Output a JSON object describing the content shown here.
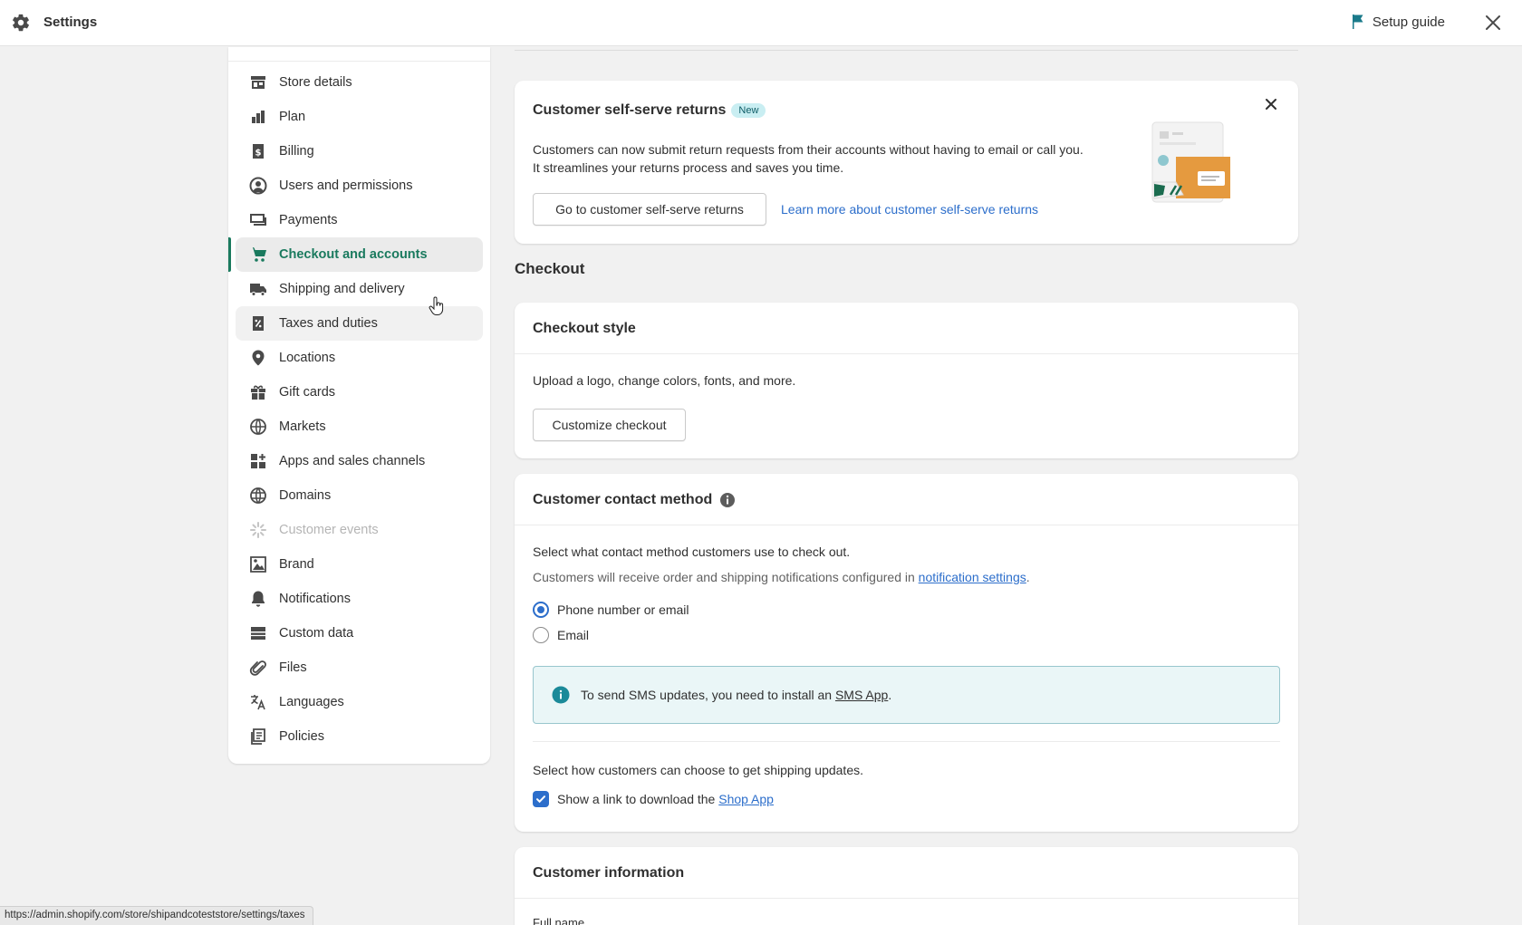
{
  "header": {
    "title": "Settings",
    "setup_guide": "Setup guide"
  },
  "sidebar": {
    "items": [
      {
        "label": "Store details",
        "icon": "store-icon"
      },
      {
        "label": "Plan",
        "icon": "plan-icon"
      },
      {
        "label": "Billing",
        "icon": "billing-icon"
      },
      {
        "label": "Users and permissions",
        "icon": "user-icon"
      },
      {
        "label": "Payments",
        "icon": "payments-icon"
      },
      {
        "label": "Checkout and accounts",
        "icon": "cart-icon",
        "state": "active"
      },
      {
        "label": "Shipping and delivery",
        "icon": "truck-icon"
      },
      {
        "label": "Taxes and duties",
        "icon": "tax-icon",
        "state": "hover"
      },
      {
        "label": "Locations",
        "icon": "location-icon"
      },
      {
        "label": "Gift cards",
        "icon": "gift-icon"
      },
      {
        "label": "Markets",
        "icon": "globe-icon"
      },
      {
        "label": "Apps and sales channels",
        "icon": "apps-icon"
      },
      {
        "label": "Domains",
        "icon": "domain-icon"
      },
      {
        "label": "Customer events",
        "icon": "sparkle-icon",
        "state": "disabled"
      },
      {
        "label": "Brand",
        "icon": "brand-icon"
      },
      {
        "label": "Notifications",
        "icon": "bell-icon"
      },
      {
        "label": "Custom data",
        "icon": "database-icon"
      },
      {
        "label": "Files",
        "icon": "paperclip-icon"
      },
      {
        "label": "Languages",
        "icon": "translate-icon"
      },
      {
        "label": "Policies",
        "icon": "policy-icon"
      }
    ]
  },
  "promo": {
    "title": "Customer self-serve returns",
    "badge": "New",
    "line1": "Customers can now submit return requests from their accounts without having to email or call you.",
    "line2": "It streamlines your returns process and saves you time.",
    "button": "Go to customer self-serve returns",
    "link": "Learn more about customer self-serve returns"
  },
  "checkout": {
    "section_title": "Checkout",
    "style": {
      "title": "Checkout style",
      "desc": "Upload a logo, change colors, fonts, and more.",
      "button": "Customize checkout"
    },
    "contact": {
      "title": "Customer contact method",
      "line1": "Select what contact method customers use to check out.",
      "line2_prefix": "Customers will receive order and shipping notifications configured in ",
      "line2_link": "notification settings",
      "line2_suffix": ".",
      "options": [
        {
          "label": "Phone number or email",
          "selected": true
        },
        {
          "label": "Email",
          "selected": false
        }
      ],
      "banner_prefix": "To send SMS updates, you need to install an ",
      "banner_link": "SMS App",
      "banner_suffix": ".",
      "line3": "Select how customers can choose to get shipping updates.",
      "checkbox_prefix": "Show a link to download the ",
      "checkbox_link": "Shop App",
      "checkbox_checked": true
    },
    "info": {
      "title": "Customer information",
      "sub": "Full name"
    }
  },
  "status_url": "https://admin.shopify.com/store/shipandcoteststore/settings/taxes",
  "colors": {
    "accent": "#1a7a5e",
    "link": "#2c6ecb",
    "banner_bg": "#eaf6f7"
  }
}
